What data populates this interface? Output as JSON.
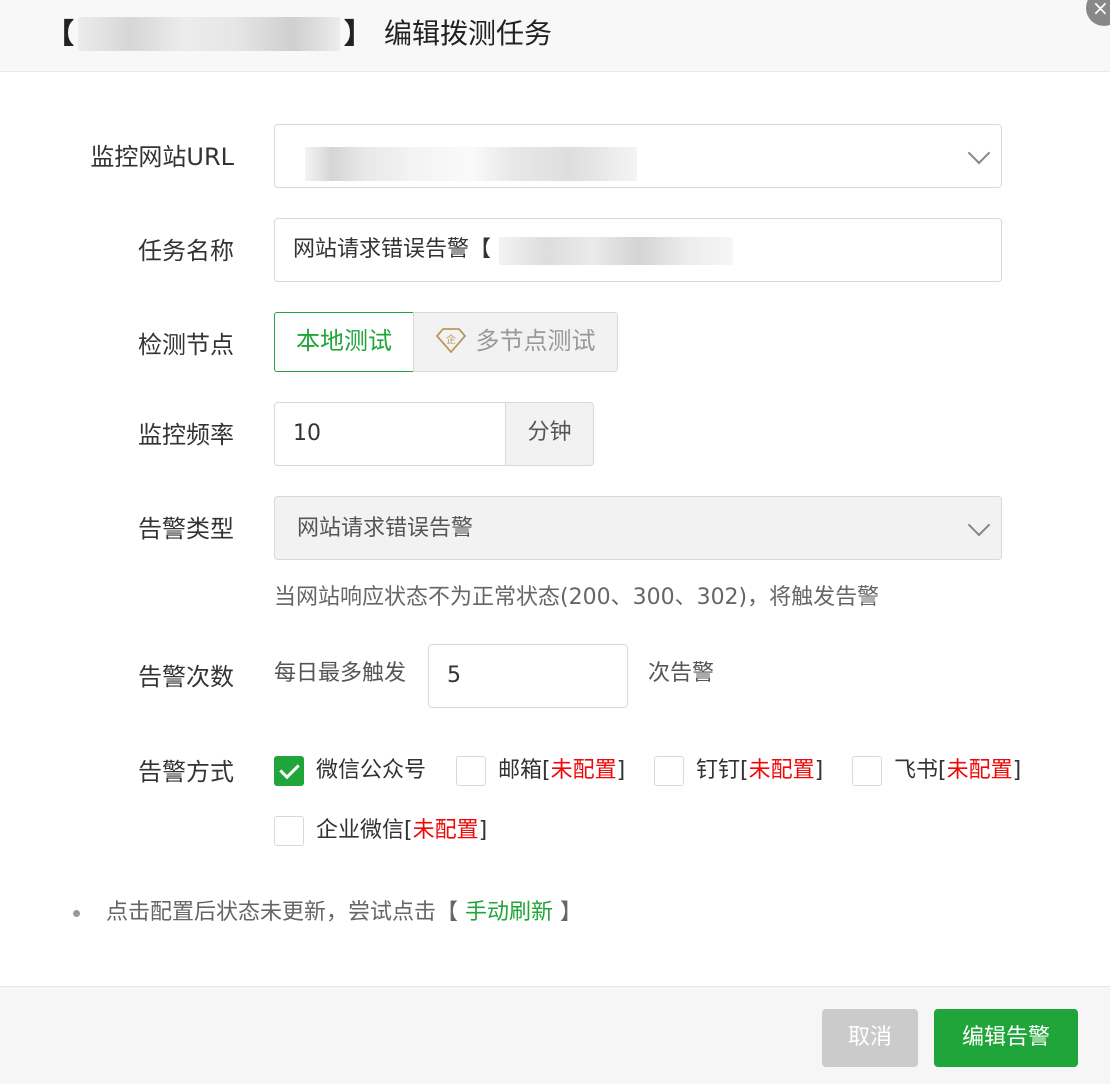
{
  "header": {
    "bracket_open": "【",
    "bracket_close": "】",
    "title": "编辑拨测任务"
  },
  "form": {
    "url": {
      "label": "监控网站URL"
    },
    "task_name": {
      "label": "任务名称",
      "value_prefix": "网站请求错误告警【"
    },
    "node": {
      "label": "检测节点",
      "options": [
        "本地测试",
        "多节点测试"
      ],
      "selected": "本地测试",
      "premium_icon_text": "企"
    },
    "frequency": {
      "label": "监控频率",
      "value": "10",
      "unit": "分钟"
    },
    "alert_type": {
      "label": "告警类型",
      "selected": "网站请求错误告警",
      "hint": "当网站响应状态不为正常状态(200、300、302)，将触发告警"
    },
    "alert_count": {
      "label": "告警次数",
      "prefix": "每日最多触发",
      "value": "5",
      "suffix": "次告警"
    },
    "alert_method": {
      "label": "告警方式",
      "unconfigured": "未配置",
      "options": [
        {
          "name": "微信公众号",
          "checked": true,
          "configured": true
        },
        {
          "name": "邮箱",
          "checked": false,
          "configured": false
        },
        {
          "name": "钉钉",
          "checked": false,
          "configured": false
        },
        {
          "name": "飞书",
          "checked": false,
          "configured": false
        },
        {
          "name": "企业微信",
          "checked": false,
          "configured": false
        }
      ]
    }
  },
  "tip": {
    "text": "点击配置后状态未更新，尝试点击【 ",
    "link": "手动刷新",
    "text_end": " 】"
  },
  "footer": {
    "cancel": "取消",
    "submit": "编辑告警"
  },
  "colors": {
    "accent": "#20a53a",
    "warning": "#ef0808"
  }
}
